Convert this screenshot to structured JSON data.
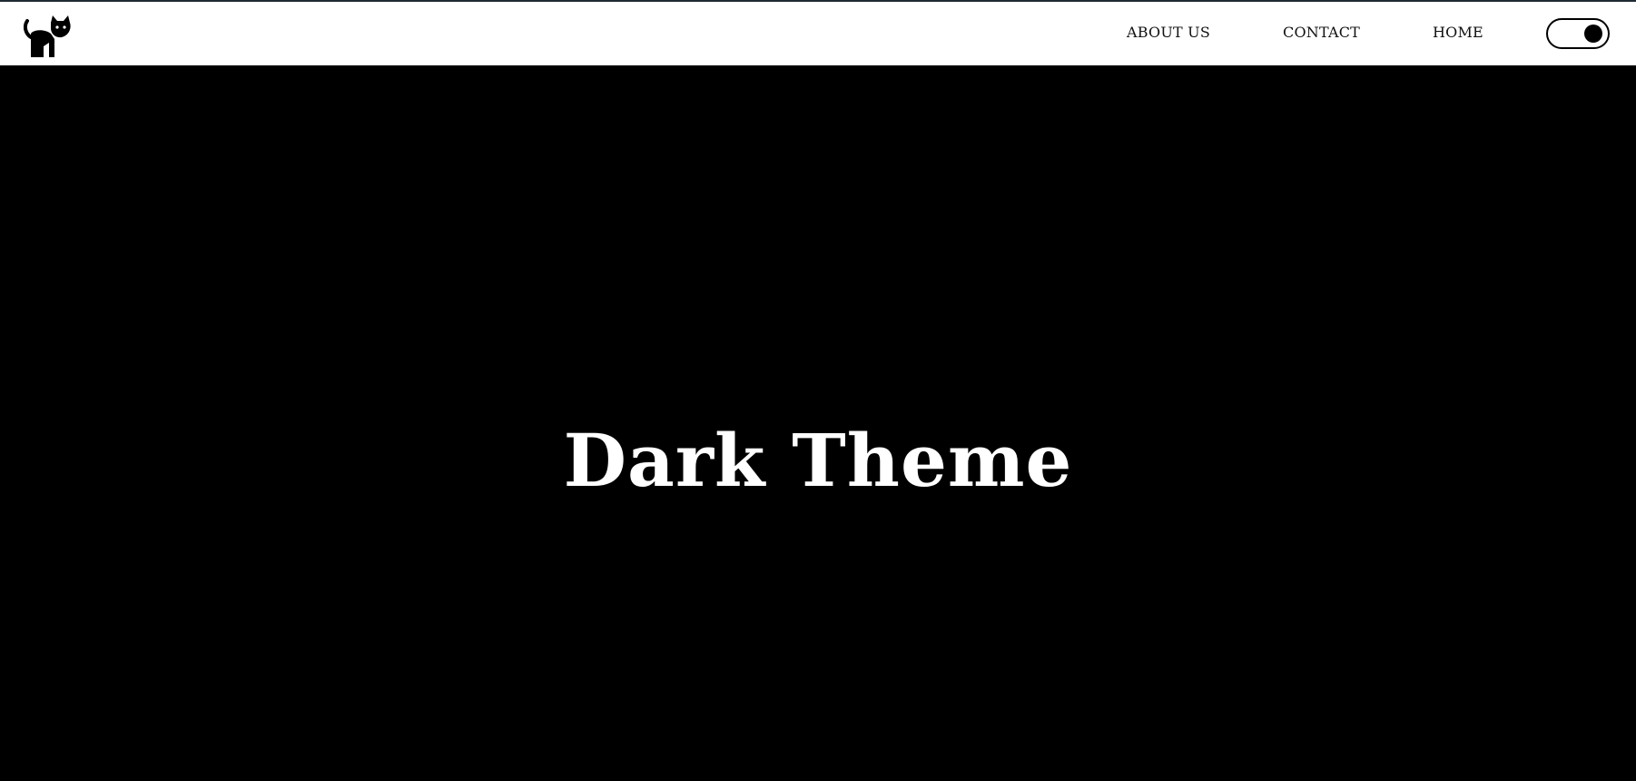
{
  "navbar": {
    "logo_icon": "cat-icon",
    "links": [
      {
        "label": "ABOUT US"
      },
      {
        "label": "CONTACT"
      },
      {
        "label": "HOME"
      }
    ],
    "theme_toggle": {
      "state": "dark",
      "on": true
    }
  },
  "hero": {
    "title": "Dark Theme"
  },
  "colors": {
    "navbar_bg": "#ffffff",
    "hero_bg": "#000000",
    "text_light": "#ffffff",
    "text_dark": "#111111"
  }
}
